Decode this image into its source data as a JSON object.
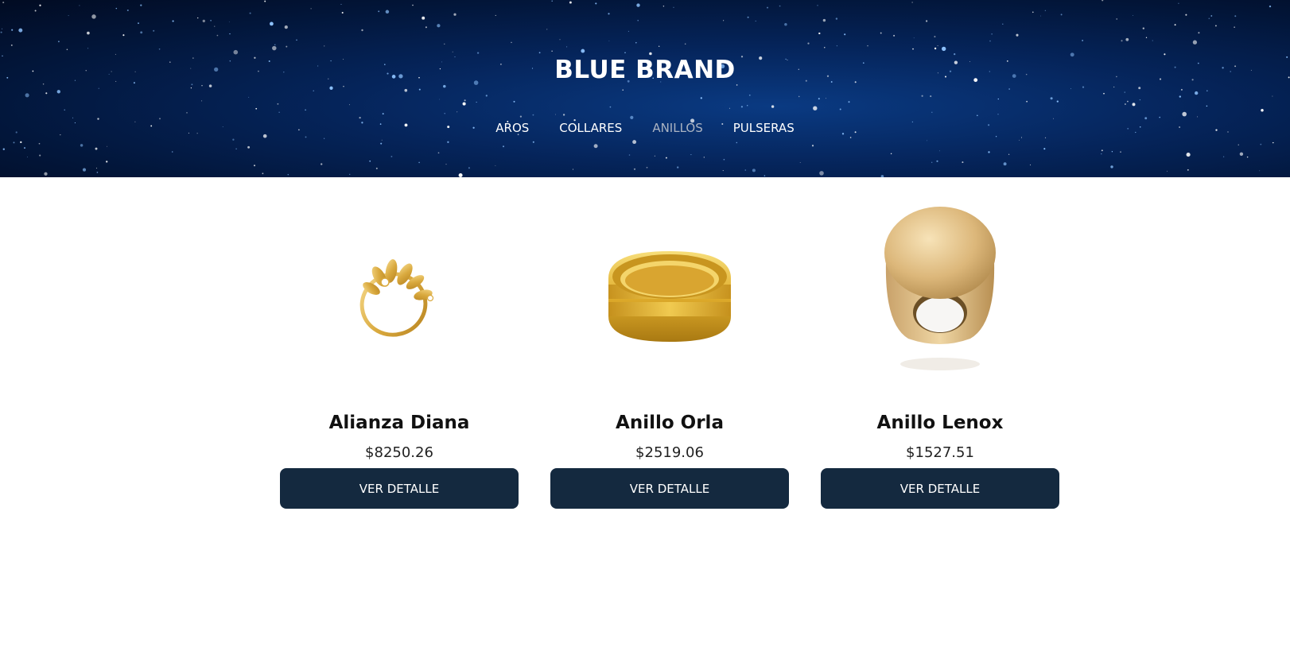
{
  "header": {
    "brand": "BLUE BRAND",
    "nav": [
      {
        "label": "AROS",
        "active": false
      },
      {
        "label": "COLLARES",
        "active": false
      },
      {
        "label": "ANILLOS",
        "active": true
      },
      {
        "label": "PULSERAS",
        "active": false
      }
    ]
  },
  "products": [
    {
      "name": "Alianza Diana",
      "price": "$8250.26",
      "button": "VER DETALLE",
      "image": "gold-leaf-ring"
    },
    {
      "name": "Anillo Orla",
      "price": "$2519.06",
      "button": "VER DETALLE",
      "image": "gold-band-ring"
    },
    {
      "name": "Anillo Lenox",
      "price": "$1527.51",
      "button": "VER DETALLE",
      "image": "gold-signet-ring"
    }
  ],
  "colors": {
    "hero_bg": "#05245a",
    "button_bg": "#14293f",
    "nav_active": "#aab3c2"
  }
}
